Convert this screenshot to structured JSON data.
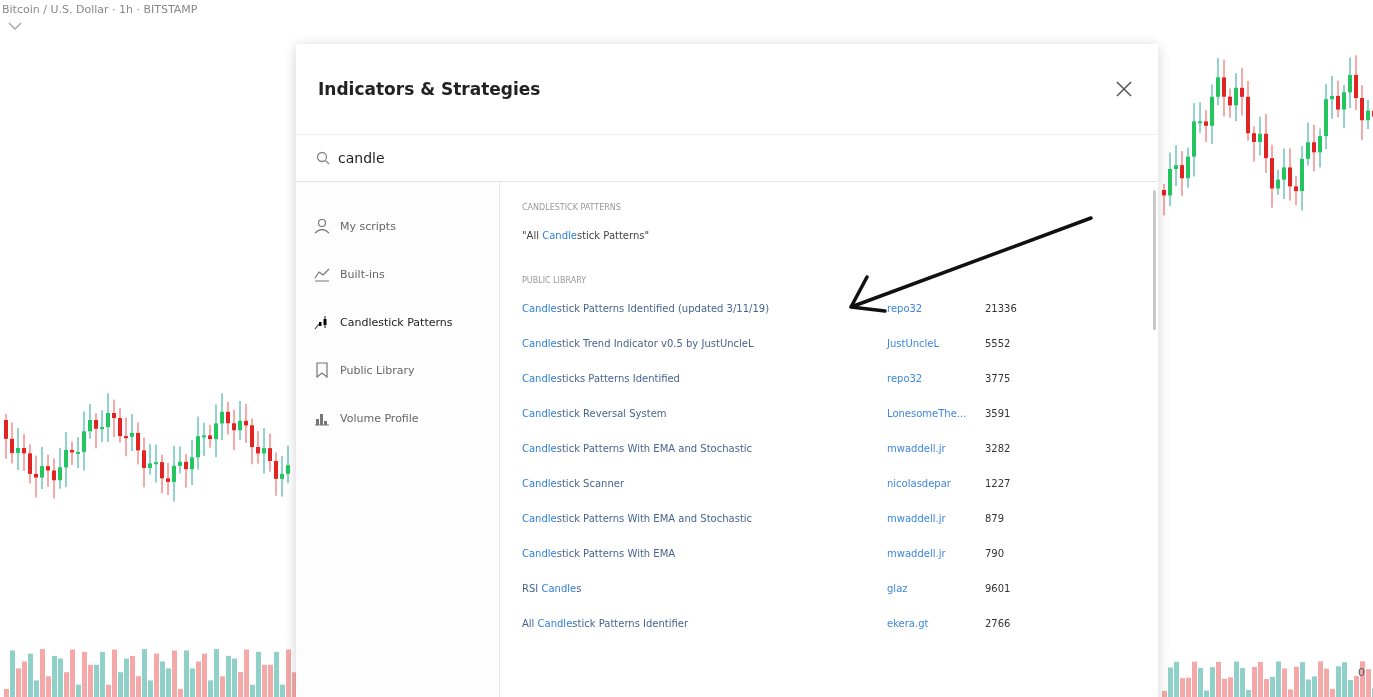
{
  "chart": {
    "symbol": "Bitcoin / U.S. Dollar · 1h · BITSTAMP",
    "axis_label": "0"
  },
  "dialog": {
    "title": "Indicators & Strategies",
    "search": {
      "value": "candle"
    },
    "sidebar": {
      "items": [
        {
          "label": "My scripts",
          "selected": false
        },
        {
          "label": "Built-ins",
          "selected": false
        },
        {
          "label": "Candlestick Patterns",
          "selected": true
        },
        {
          "label": "Public Library",
          "selected": false
        },
        {
          "label": "Volume Profile",
          "selected": false
        }
      ]
    },
    "sections": [
      {
        "heading": "CANDLESTICK PATTERNS",
        "rows": [
          {
            "name": [
              {
                "text": "\"All ",
                "match": false
              },
              {
                "text": "Candle",
                "match": true
              },
              {
                "text": "stick Patterns\"",
                "match": false
              }
            ]
          }
        ]
      },
      {
        "heading": "PUBLIC LIBRARY",
        "rows": [
          {
            "name": [
              {
                "text": "Candle",
                "match": true
              },
              {
                "text": "stick Patterns Identified (updated 3/11/19)",
                "match": false
              }
            ],
            "author": "repo32",
            "count": "21336"
          },
          {
            "name": [
              {
                "text": "Candle",
                "match": true
              },
              {
                "text": "stick Trend Indicator v0.5 by JustUncleL",
                "match": false
              }
            ],
            "author": "JustUncleL",
            "count": "5552"
          },
          {
            "name": [
              {
                "text": "Candle",
                "match": true
              },
              {
                "text": "sticks Patterns Identified",
                "match": false
              }
            ],
            "author": "repo32",
            "count": "3775"
          },
          {
            "name": [
              {
                "text": "Candle",
                "match": true
              },
              {
                "text": "stick Reversal System",
                "match": false
              }
            ],
            "author": "LonesomeThe...",
            "count": "3591"
          },
          {
            "name": [
              {
                "text": "Candle",
                "match": true
              },
              {
                "text": "stick Patterns With EMA and Stochastic",
                "match": false
              }
            ],
            "author": "mwaddell.jr",
            "count": "3282"
          },
          {
            "name": [
              {
                "text": "Candle",
                "match": true
              },
              {
                "text": "stick Scanner",
                "match": false
              }
            ],
            "author": "nicolasdepar",
            "count": "1227"
          },
          {
            "name": [
              {
                "text": "Candle",
                "match": true
              },
              {
                "text": "stick Patterns With EMA and Stochastic",
                "match": false
              }
            ],
            "author": "mwaddell.jr",
            "count": "879"
          },
          {
            "name": [
              {
                "text": "Candle",
                "match": true
              },
              {
                "text": "stick Patterns With EMA",
                "match": false
              }
            ],
            "author": "mwaddell.jr",
            "count": "790"
          },
          {
            "name": [
              {
                "text": "RSI ",
                "match": false
              },
              {
                "text": "Candle",
                "match": true
              },
              {
                "text": "s",
                "match": false
              }
            ],
            "author": "glaz",
            "count": "9601"
          },
          {
            "name": [
              {
                "text": "All ",
                "match": false
              },
              {
                "text": "Candle",
                "match": true
              },
              {
                "text": "stick Patterns Identifier",
                "match": false
              }
            ],
            "author": "ekera.gt",
            "count": "2766"
          }
        ]
      }
    ]
  }
}
